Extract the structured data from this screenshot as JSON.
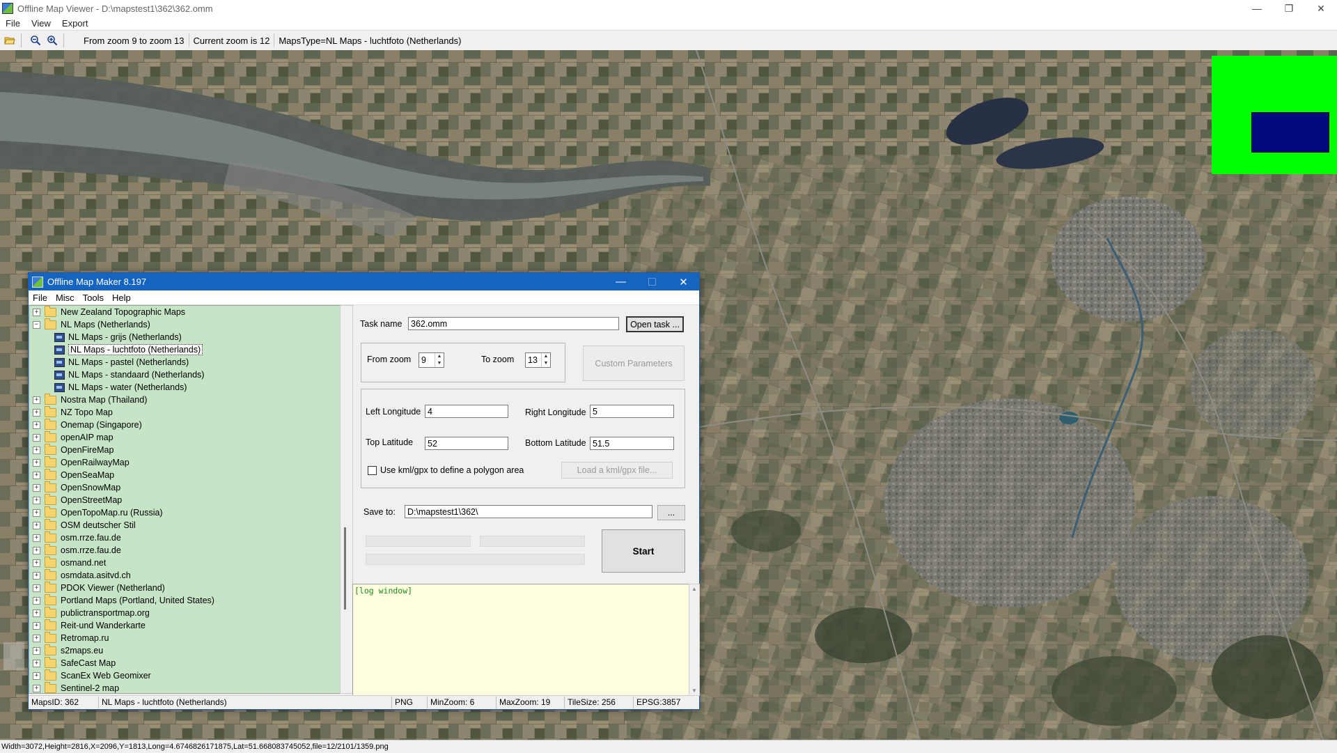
{
  "viewer": {
    "title": "Offline Map Viewer - D:\\mapstest1\\362\\362.omm",
    "menu": [
      "File",
      "View",
      "Export"
    ],
    "toolbar": {
      "zoom_range": "From zoom 9 to zoom 13",
      "current_zoom": "Current zoom is 12",
      "maps_type": "MapsType=NL Maps - luchtfoto (Netherlands)"
    },
    "status": "Width=3072,Height=2816,X=2096,Y=1813,Long=4.6746826171875,Lat=51.668083745052,file=12/2101/1359.png",
    "overview_colors": {
      "background": "#00ff00",
      "viewport": "#000a7a"
    }
  },
  "dialog": {
    "title": "Offline Map Maker 8.197",
    "menu": [
      "File",
      "Misc",
      "Tools",
      "Help"
    ],
    "tree": {
      "items": [
        {
          "label": "New Zealand Topographic Maps",
          "level": 0,
          "expanded": false
        },
        {
          "label": "NL Maps (Netherlands)",
          "level": 0,
          "expanded": true
        },
        {
          "label": "NL Maps - grijs (Netherlands)",
          "level": 1
        },
        {
          "label": "NL Maps - luchtfoto (Netherlands)",
          "level": 1,
          "selected": true
        },
        {
          "label": "NL Maps - pastel (Netherlands)",
          "level": 1
        },
        {
          "label": "NL Maps - standaard (Netherlands)",
          "level": 1
        },
        {
          "label": "NL Maps - water (Netherlands)",
          "level": 1
        },
        {
          "label": "Nostra Map (Thailand)",
          "level": 0
        },
        {
          "label": "NZ Topo Map",
          "level": 0
        },
        {
          "label": "Onemap (Singapore)",
          "level": 0
        },
        {
          "label": "openAIP map",
          "level": 0
        },
        {
          "label": "OpenFireMap",
          "level": 0
        },
        {
          "label": "OpenRailwayMap",
          "level": 0
        },
        {
          "label": "OpenSeaMap",
          "level": 0
        },
        {
          "label": "OpenSnowMap",
          "level": 0
        },
        {
          "label": "OpenStreetMap",
          "level": 0
        },
        {
          "label": "OpenTopoMap.ru (Russia)",
          "level": 0
        },
        {
          "label": "OSM deutscher Stil",
          "level": 0
        },
        {
          "label": "osm.rrze.fau.de",
          "level": 0
        },
        {
          "label": "osm.rrze.fau.de",
          "level": 0
        },
        {
          "label": "osmand.net",
          "level": 0
        },
        {
          "label": "osmdata.asitvd.ch",
          "level": 0
        },
        {
          "label": "PDOK Viewer (Netherland)",
          "level": 0
        },
        {
          "label": "Portland Maps (Portland, United States)",
          "level": 0
        },
        {
          "label": "publictransportmap.org",
          "level": 0
        },
        {
          "label": "Reit-und Wanderkarte",
          "level": 0
        },
        {
          "label": "Retromap.ru",
          "level": 0
        },
        {
          "label": "s2maps.eu",
          "level": 0
        },
        {
          "label": "SafeCast Map",
          "level": 0
        },
        {
          "label": "ScanEx Web Geomixer",
          "level": 0
        },
        {
          "label": "Sentinel-2 map",
          "level": 0
        }
      ]
    },
    "task": {
      "label": "Task name",
      "value": "362.omm",
      "open_button": "Open task ..."
    },
    "zoom": {
      "from_label": "From zoom",
      "from_value": "9",
      "to_label": "To zoom",
      "to_value": "13",
      "custom_button": "Custom Parameters"
    },
    "coords": {
      "left_lon_label": "Left Longitude",
      "left_lon": "4",
      "right_lon_label": "Right Longitude",
      "right_lon": "5",
      "top_lat_label": "Top Latitude",
      "top_lat": "52",
      "bottom_lat_label": "Bottom Latitude",
      "bottom_lat": "51.5",
      "kml_checkbox_label": "Use kml/gpx to define a polygon area",
      "kml_checked": false,
      "kml_button": "Load a kml/gpx file..."
    },
    "save": {
      "label": "Save to:",
      "value": "D:\\mapstest1\\362\\",
      "browse": "..."
    },
    "start_button": "Start",
    "log_text": "[log window]",
    "status": {
      "maps_id": "MapsID: 362",
      "map_name": "NL Maps - luchtfoto (Netherlands)",
      "format": "PNG",
      "min_zoom": "MinZoom: 6",
      "max_zoom": "MaxZoom: 19",
      "tile_size": "TileSize: 256",
      "epsg": "EPSG:3857"
    }
  }
}
